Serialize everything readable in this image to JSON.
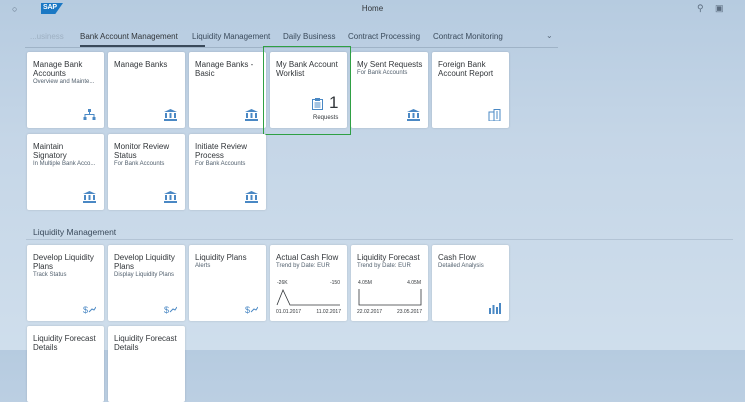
{
  "header": {
    "title": "Home",
    "logo_text": "SAP"
  },
  "tabs": [
    {
      "label": "...usiness"
    },
    {
      "label": "Bank Account Management"
    },
    {
      "label": "Liquidity Management"
    },
    {
      "label": "Daily Business"
    },
    {
      "label": "Contract Processing"
    },
    {
      "label": "Contract Monitoring"
    }
  ],
  "tiles_row1": [
    {
      "title": "Manage Bank Accounts",
      "subtitle": "Overview and Mainte..."
    },
    {
      "title": "Manage Banks",
      "subtitle": ""
    },
    {
      "title": "Manage Banks - Basic",
      "subtitle": ""
    },
    {
      "title": "My Bank Account Worklist",
      "subtitle": "",
      "count": "1",
      "unit": "Requests"
    },
    {
      "title": "My Sent Requests",
      "subtitle": "For Bank Accounts"
    },
    {
      "title": "Foreign Bank Account Report",
      "subtitle": ""
    }
  ],
  "tiles_row2": [
    {
      "title": "Maintain Signatory",
      "subtitle": "In Multiple Bank Acco..."
    },
    {
      "title": "Monitor Review Status",
      "subtitle": "For Bank Accounts"
    },
    {
      "title": "Initiate Review Process",
      "subtitle": "For Bank Accounts"
    }
  ],
  "section": {
    "title": "Liquidity Management"
  },
  "tiles_row3": [
    {
      "title": "Develop Liquidity Plans",
      "subtitle": "Track Status"
    },
    {
      "title": "Develop Liquidity Plans",
      "subtitle": "Display Liquidity Plans"
    },
    {
      "title": "Liquidity Plans",
      "subtitle": "Alerts"
    },
    {
      "title": "Actual Cash Flow",
      "subtitle": "Trend by Date: EUR",
      "v_start": "-26K",
      "v_end": "-150",
      "d_start": "01.01.2017",
      "d_end": "11.02.2017"
    },
    {
      "title": "Liquidity Forecast",
      "subtitle": "Trend by Date: EUR",
      "v_start": "4.05M",
      "v_end": "4.05M",
      "d_start": "22.02.2017",
      "d_end": "23.05.2017"
    },
    {
      "title": "Cash Flow",
      "subtitle": "Detailed Analysis"
    }
  ],
  "tiles_row4": [
    {
      "title": "Liquidity Forecast Details",
      "subtitle": ""
    },
    {
      "title": "Liquidity Forecast Details",
      "subtitle": ""
    }
  ]
}
